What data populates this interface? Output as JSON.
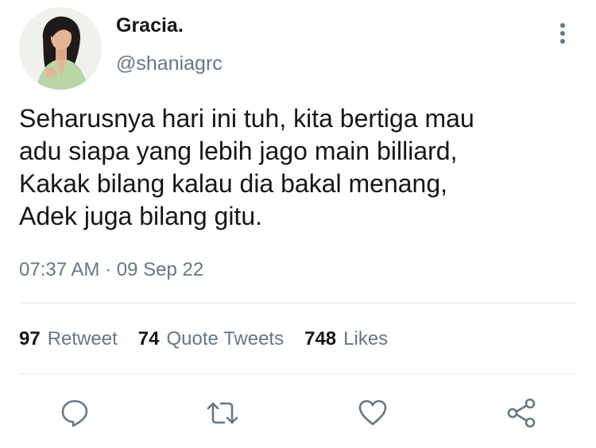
{
  "author": {
    "display_name": "Gracia.",
    "handle": "@shaniagrc"
  },
  "tweet": {
    "text": "Seharusnya hari ini tuh, kita bertiga mau\nadu siapa yang lebih jago main billiard,\nKakak bilang kalau dia bakal menang,\nAdek juga bilang gitu.",
    "timestamp": "07:37 AM · 09 Sep 22"
  },
  "stats": {
    "retweets": {
      "count": "97",
      "label": "Retweet"
    },
    "quotes": {
      "count": "74",
      "label": "Quote Tweets"
    },
    "likes": {
      "count": "748",
      "label": "Likes"
    }
  },
  "icons": {
    "more": "more-vertical-icon",
    "reply": "reply-icon",
    "retweet": "retweet-icon",
    "like": "heart-icon",
    "share": "share-icon"
  },
  "colors": {
    "text_primary": "#14171a",
    "text_secondary": "#657786",
    "divider": "#e1e8ed",
    "icon": "#657786"
  }
}
